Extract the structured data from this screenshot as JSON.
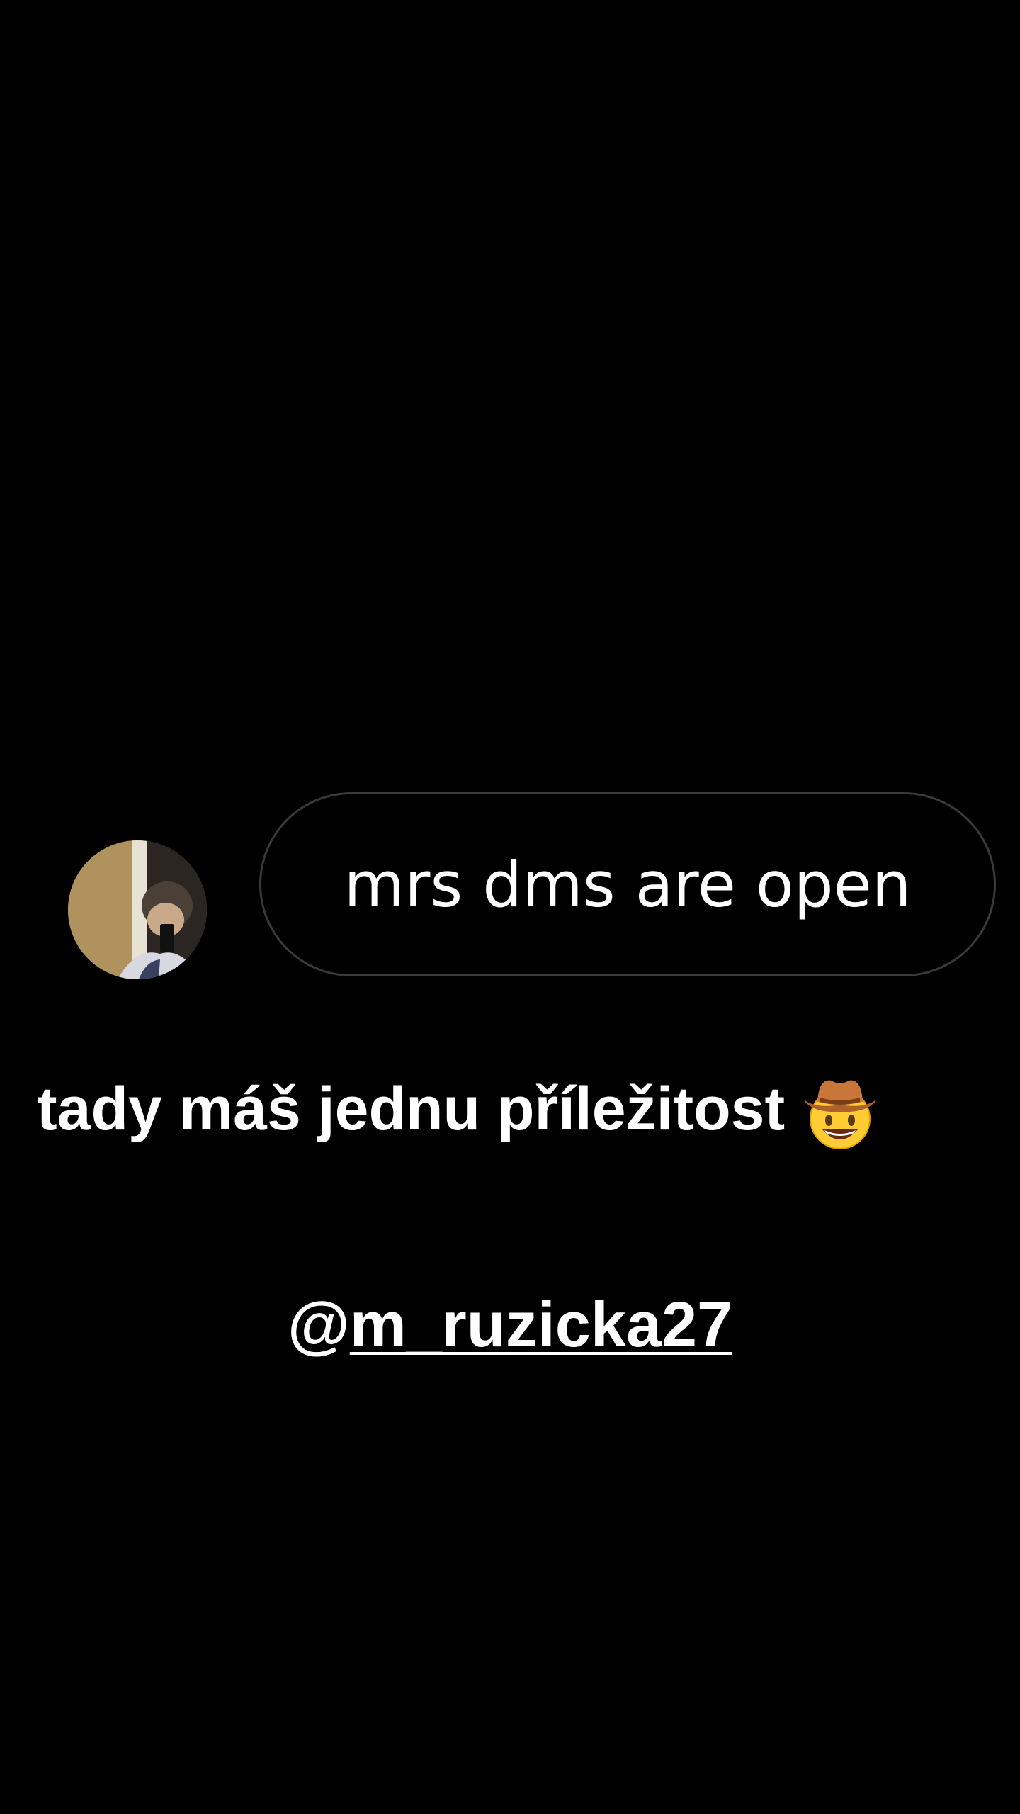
{
  "story": {
    "background_color": "#000000",
    "avatar": {
      "icon": "profile-photo"
    },
    "bubble": {
      "text": "mrs dms are open",
      "border_color": "#3a3a3a"
    },
    "caption": {
      "text": "tady máš jednu příležitost",
      "emoji": "cowboy-hat-face-emoji"
    },
    "mention": {
      "at": "@",
      "username": "m_ruzicka27"
    }
  }
}
